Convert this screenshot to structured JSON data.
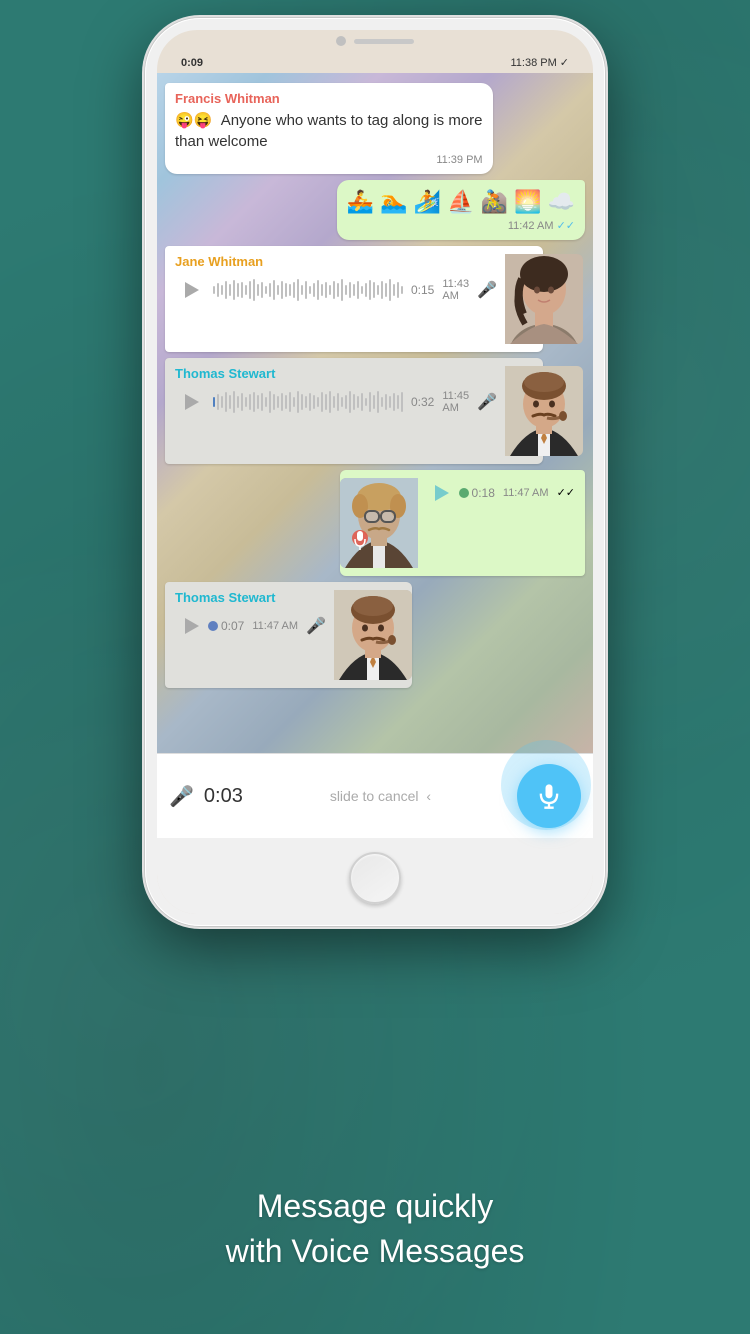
{
  "status_bar": {
    "time": "0:09",
    "right_time": "11:38 PM",
    "check": "✓"
  },
  "chat": {
    "messages": [
      {
        "id": "msg1",
        "type": "received_text",
        "sender": "Francis Whitman",
        "sender_color": "francis",
        "text": "😜😝  Anyone who wants to tag along is more than welcome",
        "time": "11:39 PM",
        "checked": false
      },
      {
        "id": "msg2",
        "type": "sent_emoji",
        "emoji": "🚣‍♂️🏊‍♂️🏄‍♂️⛵🚵☀️☁️",
        "time": "11:42 AM",
        "checked": true
      },
      {
        "id": "msg3",
        "type": "received_voice",
        "sender": "Jane Whitman",
        "sender_color": "jane",
        "duration": "0:15",
        "time": "11:43 AM",
        "mic": true
      },
      {
        "id": "msg4",
        "type": "received_voice",
        "sender": "Thomas Stewart",
        "sender_color": "thomas",
        "duration": "0:32",
        "time": "11:45 AM",
        "mic": true
      },
      {
        "id": "msg5",
        "type": "sent_voice",
        "duration": "0:18",
        "time": "11:47 AM",
        "checked": true
      },
      {
        "id": "msg6",
        "type": "received_voice",
        "sender": "Thomas Stewart",
        "sender_color": "thomas",
        "duration": "0:07",
        "time": "11:47 AM",
        "mic": true
      }
    ]
  },
  "recording": {
    "time": "0:03",
    "cancel_text": "slide to cancel",
    "cancel_arrow": "‹"
  },
  "promo": {
    "line1": "Message quickly",
    "line2": "with Voice Messages"
  },
  "labels": {
    "play_icon": "▶",
    "mic_icon": "🎤"
  }
}
